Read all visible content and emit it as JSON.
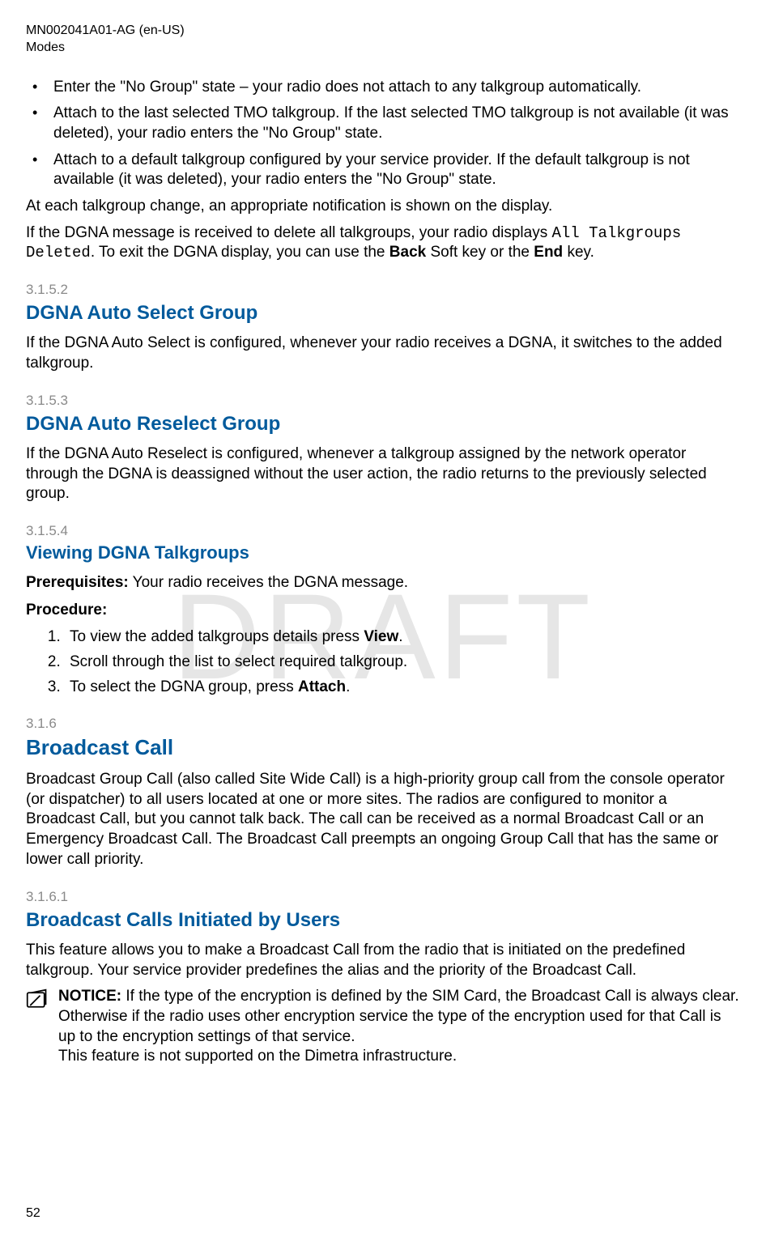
{
  "header": {
    "doc_id": "MN002041A01-AG (en-US)",
    "chapter": "Modes"
  },
  "watermark": "DRAFT",
  "bullets": [
    "Enter the \"No Group\" state – your radio does not attach to any talkgroup automatically.",
    "Attach to the last selected TMO talkgroup. If the last selected TMO talkgroup is not available (it was deleted), your radio enters the \"No Group\" state.",
    "Attach to a default talkgroup configured by your service provider. If the default talkgroup is not available (it was deleted), your radio enters the \"No Group\" state."
  ],
  "para_after_bullets": "At each talkgroup change, an appropriate notification is shown on the display.",
  "dgna_delete": {
    "lead": "If the DGNA message is received to delete all talkgroups, your radio displays ",
    "mono": "All Talkgroups Deleted",
    "after_mono_1": ". To exit the DGNA display, you can use the ",
    "back": "Back",
    "between": " Soft key or the ",
    "end": "End",
    "tail": " key."
  },
  "sec_3152": {
    "num": "3.1.5.2",
    "title": "DGNA Auto Select Group",
    "body": "If the DGNA Auto Select is configured, whenever your radio receives a DGNA, it switches to the added talkgroup."
  },
  "sec_3153": {
    "num": "3.1.5.3",
    "title": "DGNA Auto Reselect Group",
    "body": "If the DGNA Auto Reselect is configured, whenever a talkgroup assigned by the network operator through the DGNA is deassigned without the user action, the radio returns to the previously selected group."
  },
  "sec_3154": {
    "num": "3.1.5.4",
    "title": "Viewing DGNA Talkgroups",
    "prereq_label": "Prerequisites:",
    "prereq_text": " Your radio receives the DGNA message.",
    "proc_label": "Procedure:",
    "steps": {
      "s1_lead": "To view the added talkgroups details press ",
      "s1_bold": "View",
      "s1_tail": ".",
      "s2": "Scroll through the list to select required talkgroup.",
      "s3_lead": "To select the DGNA group, press ",
      "s3_bold": "Attach",
      "s3_tail": "."
    }
  },
  "sec_316": {
    "num": "3.1.6",
    "title": "Broadcast Call",
    "body": "Broadcast Group Call (also called Site Wide Call) is a high-priority group call from the console operator (or dispatcher) to all users located at one or more sites. The radios are configured to monitor a Broadcast Call, but you cannot talk back. The call can be received as a normal Broadcast Call or an Emergency Broadcast Call. The Broadcast Call preempts an ongoing Group Call that has the same or lower call priority."
  },
  "sec_3161": {
    "num": "3.1.6.1",
    "title": "Broadcast Calls Initiated by Users",
    "body": "This feature allows you to make a Broadcast Call from the radio that is initiated on the predefined talkgroup. Your service provider predefines the alias and the priority of the Broadcast Call.",
    "notice_label": "NOTICE:",
    "notice_body": " If the type of the encryption is defined by the SIM Card, the Broadcast Call is always clear. Otherwise if the radio uses other encryption service the type of the encryption used for that Call is up to the encryption settings of that service.",
    "notice_body2": "This feature is not supported on the Dimetra infrastructure."
  },
  "page_number": "52"
}
